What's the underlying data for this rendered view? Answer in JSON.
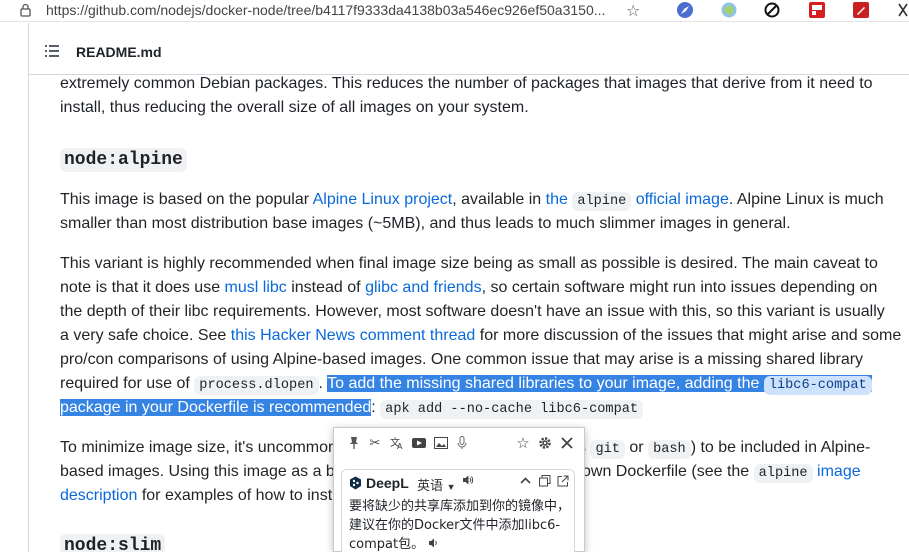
{
  "browser": {
    "url": "https://github.com/nodejs/docker-node/tree/b4117f9333da4138b03a546ec926ef50a3150...",
    "colors": {
      "highlight": "#3584e4",
      "link": "#0969da"
    }
  },
  "readme": {
    "title": "README.md"
  },
  "article": {
    "p1": {
      "l1": "extremely common Debian packages. This reduces the number of packages that images that derive from it need to",
      "l2": "install, thus reducing the overall size of all images on your system."
    },
    "h_alpine": "node:alpine",
    "p2": {
      "t1": "This image is based on the popular ",
      "link1": "Alpine Linux project",
      "t2": ", available in ",
      "link2": "the",
      "code1": "alpine",
      "link3": "official image",
      "t3": ". Alpine Linux is much",
      "l2": "smaller than most distribution base images (~5MB), and thus leads to much slimmer images in general."
    },
    "p3": {
      "l1": "This variant is highly recommended when final image size being as small as possible is desired. The main caveat to",
      "l2a": "note is that it does use ",
      "link_musl": "musl libc",
      "l2b": " instead of ",
      "link_glibc": "glibc and friends",
      "l2c": ", so certain software might run into issues depending on",
      "l3": "the depth of their libc requirements. However, most software doesn't have an issue with this, so this variant is usually",
      "l4a": "a very safe choice. See ",
      "link_hn": "this Hacker News comment thread",
      "l4b": " for more discussion of the issues that might arise and some",
      "l5": "pro/con comparisons of using Alpine-based images. One common issue that may arise is a missing shared library",
      "l6a": "required for use of ",
      "code_dlopen": "process.dlopen",
      "l6b": ". ",
      "sel1": "To add the missing shared libraries to your image, adding the ",
      "code_compat": "libc6-compat",
      "sel2": "package in your Dockerfile is recommended",
      "l7b": ": ",
      "code_apk": "apk add --no-cache libc6-compat"
    },
    "p4": {
      "l1a": "To minimize image size, it's uncommon",
      "l1b": "s ",
      "code_git": "git",
      "l1c": " or ",
      "code_bash": "bash",
      "l1d": ") to be included in Alpine-",
      "l2a": "based images. Using this image as a ba",
      "l2b": " own Dockerfile (see the ",
      "code_alpine": "alpine",
      "link_image": "image",
      "link_desc": "description",
      "l3b": " for examples of how to inst"
    },
    "h_slim": "node:slim"
  },
  "popup": {
    "provider": "DeepL",
    "language": "英语",
    "translation": "要将缺少的共享库添加到你的镜像中，建议在你的Docker文件中添加libc6-compat包。"
  }
}
